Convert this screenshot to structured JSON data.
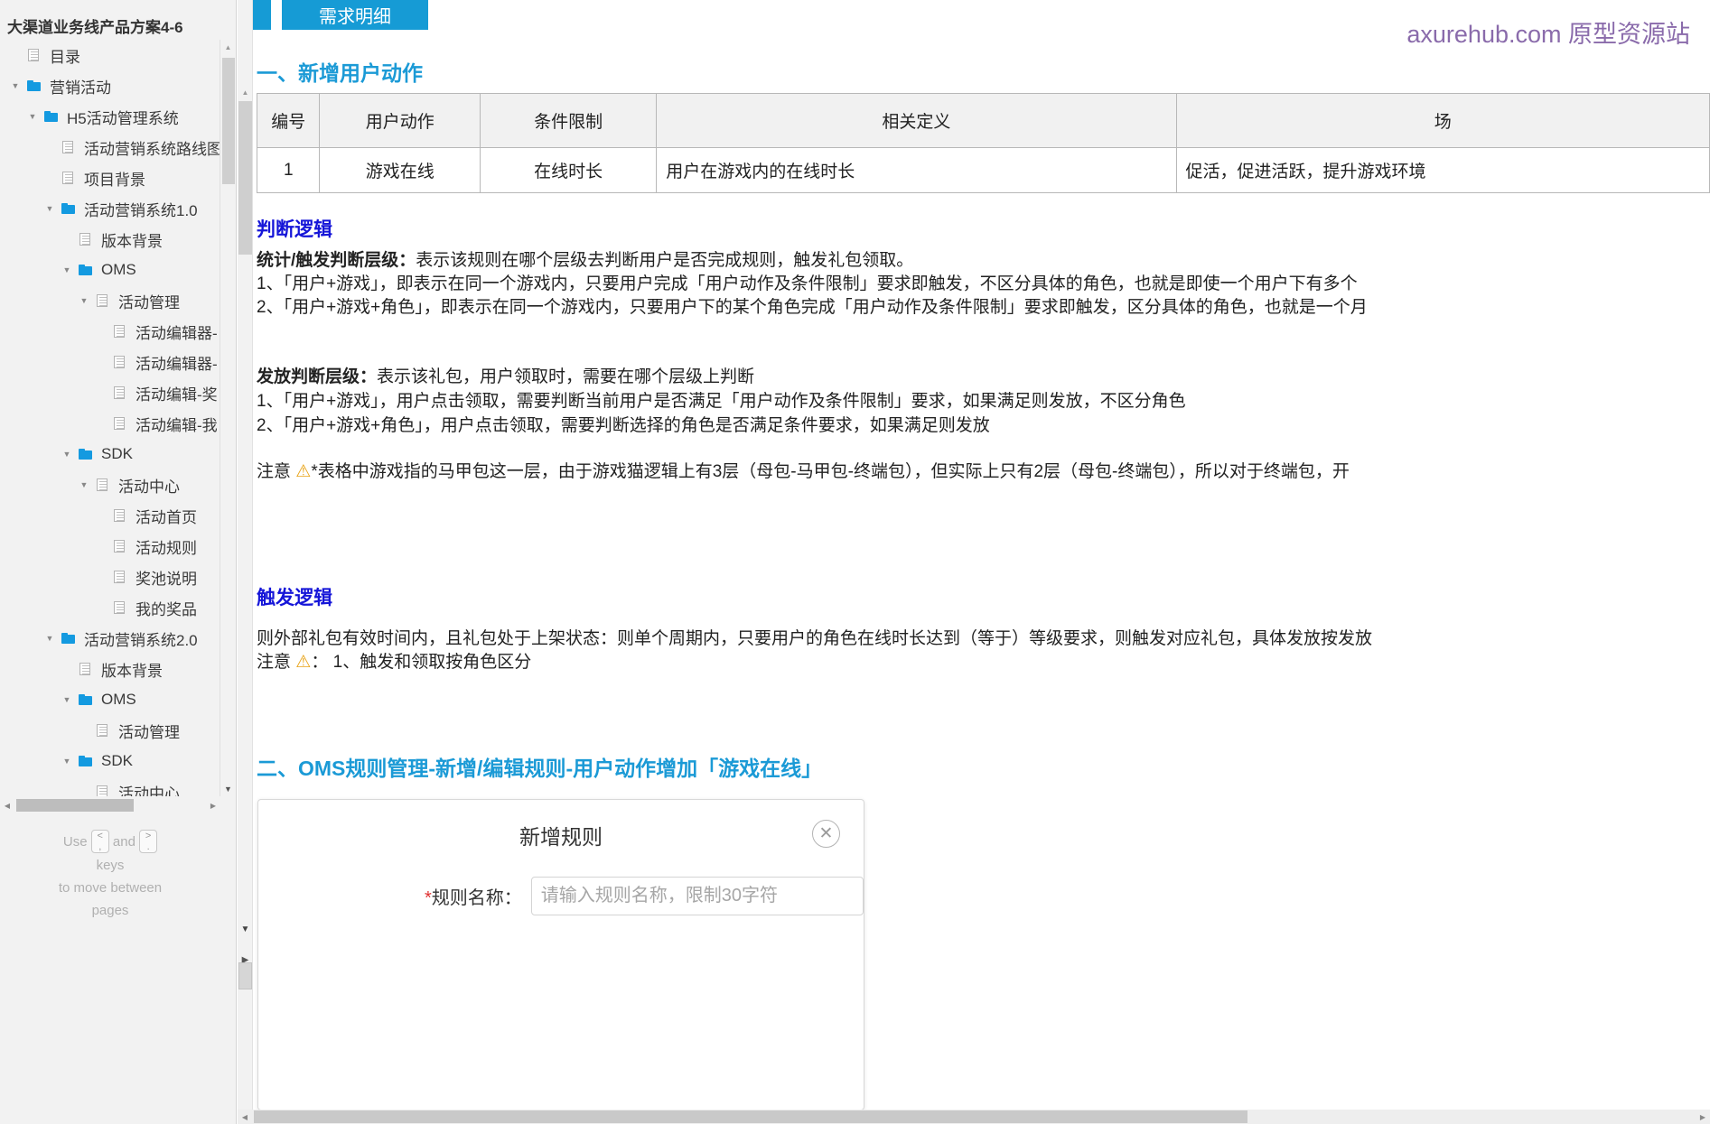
{
  "sidebar": {
    "title": "大渠道业务线产品方案4-6",
    "tree": [
      {
        "label": "目录",
        "depth": 0,
        "type": "page",
        "arrow": ""
      },
      {
        "label": "营销活动",
        "depth": 0,
        "type": "folder",
        "arrow": "down"
      },
      {
        "label": "H5活动管理系统",
        "depth": 1,
        "type": "folder",
        "arrow": "down"
      },
      {
        "label": "活动营销系统路线图",
        "depth": 2,
        "type": "page",
        "arrow": ""
      },
      {
        "label": "项目背景",
        "depth": 2,
        "type": "page",
        "arrow": ""
      },
      {
        "label": "活动营销系统1.0",
        "depth": 2,
        "type": "folder",
        "arrow": "down"
      },
      {
        "label": "版本背景",
        "depth": 3,
        "type": "page",
        "arrow": ""
      },
      {
        "label": "OMS",
        "depth": 3,
        "type": "folder",
        "arrow": "down"
      },
      {
        "label": "活动管理",
        "depth": 4,
        "type": "page",
        "arrow": "down"
      },
      {
        "label": "活动编辑器-",
        "depth": 5,
        "type": "page",
        "arrow": ""
      },
      {
        "label": "活动编辑器-",
        "depth": 5,
        "type": "page",
        "arrow": ""
      },
      {
        "label": "活动编辑-奖",
        "depth": 5,
        "type": "page",
        "arrow": ""
      },
      {
        "label": "活动编辑-我",
        "depth": 5,
        "type": "page",
        "arrow": ""
      },
      {
        "label": "SDK",
        "depth": 3,
        "type": "folder",
        "arrow": "down"
      },
      {
        "label": "活动中心",
        "depth": 4,
        "type": "page",
        "arrow": "down"
      },
      {
        "label": "活动首页",
        "depth": 5,
        "type": "page",
        "arrow": ""
      },
      {
        "label": "活动规则",
        "depth": 5,
        "type": "page",
        "arrow": ""
      },
      {
        "label": "奖池说明",
        "depth": 5,
        "type": "page",
        "arrow": ""
      },
      {
        "label": "我的奖品",
        "depth": 5,
        "type": "page",
        "arrow": ""
      },
      {
        "label": "活动营销系统2.0",
        "depth": 2,
        "type": "folder",
        "arrow": "down"
      },
      {
        "label": "版本背景",
        "depth": 3,
        "type": "page",
        "arrow": ""
      },
      {
        "label": "OMS",
        "depth": 3,
        "type": "folder",
        "arrow": "down"
      },
      {
        "label": "活动管理",
        "depth": 4,
        "type": "page",
        "arrow": ""
      },
      {
        "label": "SDK",
        "depth": 3,
        "type": "folder",
        "arrow": "down"
      },
      {
        "label": "活动中心",
        "depth": 4,
        "type": "page",
        "arrow": ""
      }
    ],
    "hint": {
      "use": "Use",
      "key_prev": "<,",
      "and": "and",
      "key_next": ">.",
      "keys": "keys",
      "line2": "to move between",
      "line3": "pages"
    }
  },
  "watermark": "axurehub.com 原型资源站",
  "tabs": {
    "active": "需求明细"
  },
  "sections": {
    "s1_heading": "一、新增用户动作",
    "judge_heading": "判断逻辑",
    "trigger_heading": "触发逻辑",
    "s2_heading": "二、OMS规则管理-新增/编辑规则-用户动作增加「游戏在线」"
  },
  "table": {
    "headers": [
      "编号",
      "用户动作",
      "条件限制",
      "相关定义",
      "场"
    ],
    "rows": [
      {
        "num": "1",
        "action": "游戏在线",
        "condition": "在线时长",
        "definition": "用户在游戏内的在线时长",
        "scene": "促活，促进活跃，提升游戏环境"
      }
    ]
  },
  "judge_logic": {
    "p1_bold": "统计/触发判断层级：",
    "p1_rest": "表示该规则在哪个层级去判断用户是否完成规则，触发礼包领取。",
    "p2": "1、「用户+游戏」，即表示在同一个游戏内，只要用户完成「用户动作及条件限制」要求即触发，不区分具体的角色，也就是即使一个用户下有多个",
    "p3": "2、「用户+游戏+角色」，即表示在同一个游戏内，只要用户下的某个角色完成「用户动作及条件限制」要求即触发，区分具体的角色，也就是一个月",
    "p4_bold": "发放判断层级：",
    "p4_rest": "表示该礼包，用户领取时，需要在哪个层级上判断",
    "p5": "1、「用户+游戏」，用户点击领取，需要判断当前用户是否满足「用户动作及条件限制」要求，如果满足则发放，不区分角色",
    "p6": "2、「用户+游戏+角色」，用户点击领取，需要判断选择的角色是否满足条件要求，如果满足则发放",
    "note_prefix": "注意",
    "note_icon": "⚠",
    "note_rest": "*表格中游戏指的马甲包这一层，由于游戏猫逻辑上有3层（母包-马甲包-终端包），但实际上只有2层（母包-终端包），所以对于终端包，开"
  },
  "trigger_logic": {
    "p1": "则外部礼包有效时间内，且礼包处于上架状态：则单个周期内，只要用户的角色在线时长达到（等于）等级要求，则触发对应礼包，具体发放按发放",
    "note_prefix": "注意",
    "note_icon": "⚠",
    "note_rest": "： 1、触发和领取按角色区分"
  },
  "modal": {
    "title": "新增规则",
    "close_icon": "✕",
    "field_label_req": "*",
    "field_label": "规则名称：",
    "field_value": "",
    "field_placeholder": "请输入规则名称，限制30字符"
  },
  "colors": {
    "accent_blue": "#169bd5",
    "heading_navy": "#1515d8",
    "watermark_purple": "#8a6bab",
    "folder_blue": "#149ae0",
    "required_red": "#e03131"
  }
}
